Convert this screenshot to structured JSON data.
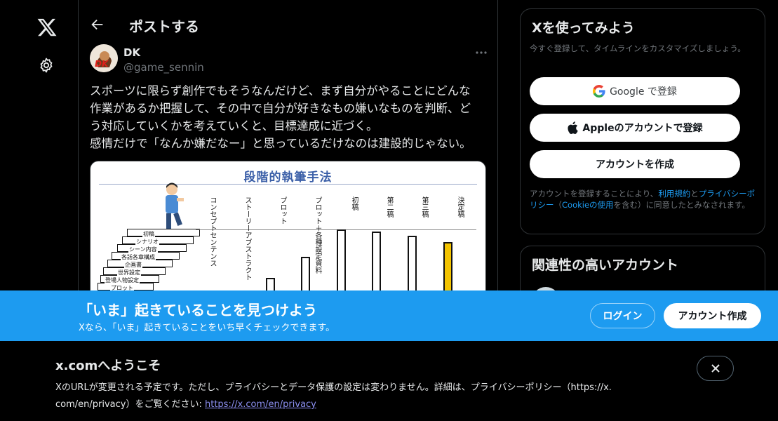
{
  "nav": {
    "logo_icon": "x-logo-icon",
    "settings_icon": "gear-icon"
  },
  "header": {
    "title": "ポストする",
    "back_icon": "back-arrow-icon"
  },
  "post": {
    "author_name": "DK",
    "author_handle": "@game_sennin",
    "avatar_text": "DK",
    "text_lines": [
      "スポーツに限らず創作でもそうなんだけど、まず自分がやることにどんな",
      "作業があるか把握して、その中で自分が好きなもの嫌いなものを判断、ど",
      "う対応していくかを考えていくと、目標達成に近づく。",
      "感情だけで「なんか嫌だなー」と思っているだけなのは建設的じゃない。"
    ],
    "image": {
      "title": "段階的執筆手法",
      "stair_labels": [
        "初稿",
        "シナリオ",
        "シーン内容",
        "各話各章構成",
        "企画書",
        "世界設定",
        "登場人物設定",
        "プロット"
      ],
      "column_labels": [
        "コンセプトセンテンス",
        "ストーリーアブストラクト",
        "プロット",
        "プロット＋各種設定資料",
        "初稿",
        "第二稿",
        "第三稿",
        "決定稿"
      ]
    }
  },
  "sidebar": {
    "signup_card": {
      "title": "Xを使ってみよう",
      "subtitle": "今すぐ登録して、タイムラインをカスタマイズしましょう。",
      "google_label": "Google で登録",
      "apple_label": "Appleのアカウントで登録",
      "create_label": "アカウントを作成",
      "legal_prefix": "アカウントを登録することにより、",
      "terms_link": "利用規約",
      "legal_and": "と",
      "privacy_link": "プライバシーポリシー",
      "legal_paren_open": "（",
      "cookie_link": "Cookieの使用",
      "legal_suffix": "を含む）に同意したとみなされます。"
    },
    "related_card": {
      "title": "関連性の高いアカウント"
    }
  },
  "banner": {
    "title": "「いま」起きていることを見つけよう",
    "subtitle": "Xなら、「いま」起きていることをいち早くチェックできます。",
    "login_label": "ログイン",
    "signup_label": "アカウント作成",
    "color": "#1d9bf0"
  },
  "notice": {
    "title": "x.comへようこそ",
    "body_line1": "XのURLが変更される予定です。ただし、プライバシーとデータ保護の設定は変わりません。詳細は、プライバシーポリシー（https://x.",
    "body_line2_prefix": "com/en/privacy）をご覧ください: ",
    "link_text": "https://x.com/en/privacy"
  }
}
